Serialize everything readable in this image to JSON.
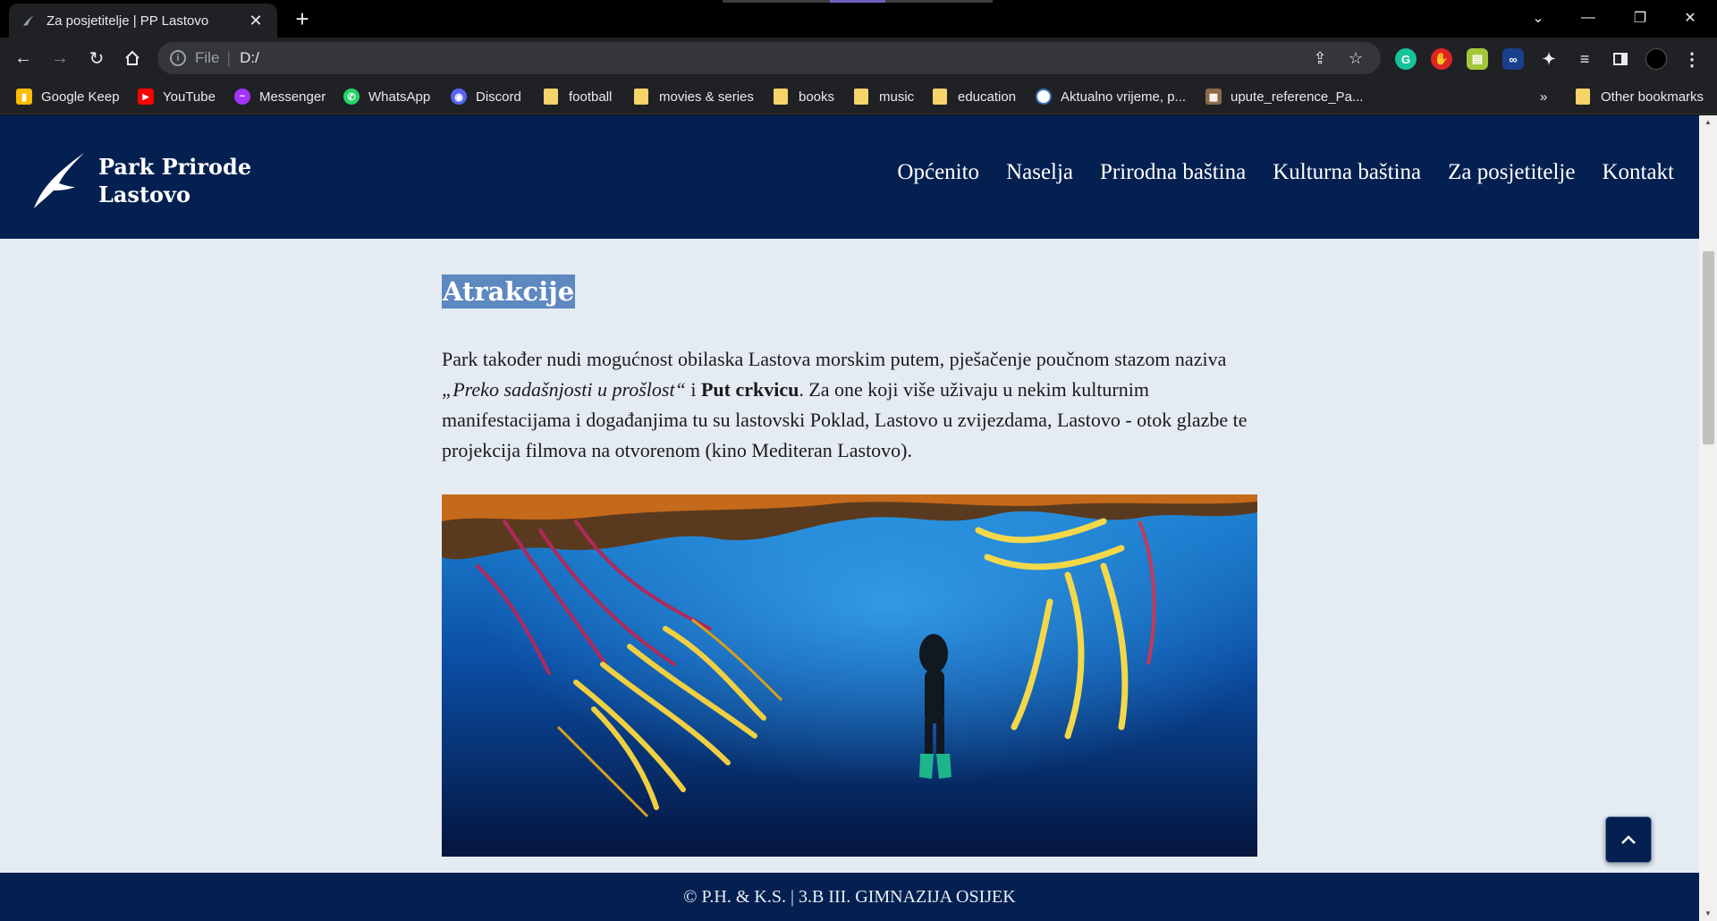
{
  "browser": {
    "tab": {
      "title": "Za posjetitelje | PP Lastovo",
      "favicon": "swallow-icon"
    },
    "address": {
      "scheme": "File",
      "url": "D:/"
    },
    "bookmarks": [
      {
        "label": "Google Keep",
        "icon": "keep-icon",
        "color": "#fbbc04"
      },
      {
        "label": "YouTube",
        "icon": "youtube-icon",
        "color": "#ff0000"
      },
      {
        "label": "Messenger",
        "icon": "messenger-icon",
        "color": "#a334fa"
      },
      {
        "label": "WhatsApp",
        "icon": "whatsapp-icon",
        "color": "#25d366"
      },
      {
        "label": "Discord",
        "icon": "discord-icon",
        "color": "#5865f2"
      },
      {
        "label": "football",
        "icon": "folder-icon"
      },
      {
        "label": "movies & series",
        "icon": "folder-icon"
      },
      {
        "label": "books",
        "icon": "folder-icon"
      },
      {
        "label": "music",
        "icon": "folder-icon"
      },
      {
        "label": "education",
        "icon": "folder-icon"
      },
      {
        "label": "Aktualno vrijeme, p...",
        "icon": "weather-icon"
      },
      {
        "label": "upute_reference_Pa...",
        "icon": "page-icon"
      }
    ],
    "overflow": "»",
    "other_bookmarks": "Other bookmarks"
  },
  "site": {
    "logo": {
      "line1": "Park Prirode",
      "line2": "Lastovo"
    },
    "nav": [
      "Općenito",
      "Naselja",
      "Prirodna baština",
      "Kulturna baština",
      "Za posjetitelje",
      "Kontakt"
    ],
    "section": {
      "heading": "Atrakcije",
      "p_part1": "Park također nudi mogućnost obilaska Lastova morskim putem, pješačenje poučnom stazom naziva ",
      "p_italic": "„Preko sadašnjosti u prošlost“",
      "p_part2": " i ",
      "p_bold": "Put crkvicu",
      "p_part3": ". Za one koji više uživaju u nekim kulturnim manifestacijama i događanjima tu su lastovski Poklad, Lastovo u zvijezdama, Lastovo - otok glazbe te projekcija filmova na otvorenom (kino Mediteran Lastovo)."
    },
    "footer": "© P.H. & K.S. | 3.B III. GIMNAZIJA OSIJEK"
  },
  "colors": {
    "header": "#042050",
    "page_bg": "#e4ebf3",
    "heading_highlight": "#5d88c0"
  }
}
